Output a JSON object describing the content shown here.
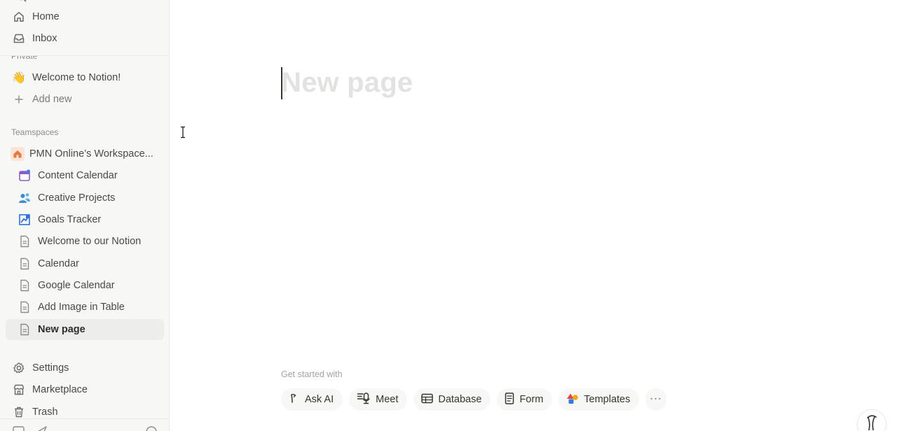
{
  "sidebar": {
    "top": [
      {
        "label": "Home",
        "icon": "home-icon"
      },
      {
        "label": "Inbox",
        "icon": "inbox-icon"
      }
    ],
    "private_label": "Private",
    "private": [
      {
        "label": "Welcome to Notion!",
        "icon": "waving-hand-icon"
      },
      {
        "label": "Add new",
        "icon": "plus-icon"
      }
    ],
    "teamspaces_label": "Teamspaces",
    "workspace": {
      "label": "PMN Online’s Workspace...",
      "icon": "house-icon"
    },
    "pages": [
      {
        "label": "Content Calendar",
        "icon": "calendar-icon"
      },
      {
        "label": "Creative Projects",
        "icon": "people-icon"
      },
      {
        "label": "Goals Tracker",
        "icon": "chart-icon"
      },
      {
        "label": "Welcome to our Notion",
        "icon": "page-icon"
      },
      {
        "label": "Calendar",
        "icon": "page-icon"
      },
      {
        "label": "Google Calendar",
        "icon": "page-icon"
      },
      {
        "label": "Add Image in Table",
        "icon": "page-icon"
      },
      {
        "label": "New page",
        "icon": "page-icon",
        "active": true
      }
    ],
    "bottom": [
      {
        "label": "Settings",
        "icon": "gear-icon"
      },
      {
        "label": "Marketplace",
        "icon": "marketplace-icon"
      },
      {
        "label": "Trash",
        "icon": "trash-icon"
      }
    ]
  },
  "main": {
    "title_placeholder": "New page",
    "get_started_label": "Get started with",
    "actions": [
      {
        "label": "Ask AI",
        "icon": "ai-icon"
      },
      {
        "label": "Meet",
        "icon": "meet-icon"
      },
      {
        "label": "Database",
        "icon": "table-icon"
      },
      {
        "label": "Form",
        "icon": "form-icon"
      },
      {
        "label": "Templates",
        "icon": "templates-icon"
      }
    ]
  },
  "colors": {
    "sidebar_bg": "#f7f7f5",
    "active_bg": "#ededeb",
    "placeholder_text": "#e3e2e0",
    "chip_bg": "#f7f7f5"
  }
}
